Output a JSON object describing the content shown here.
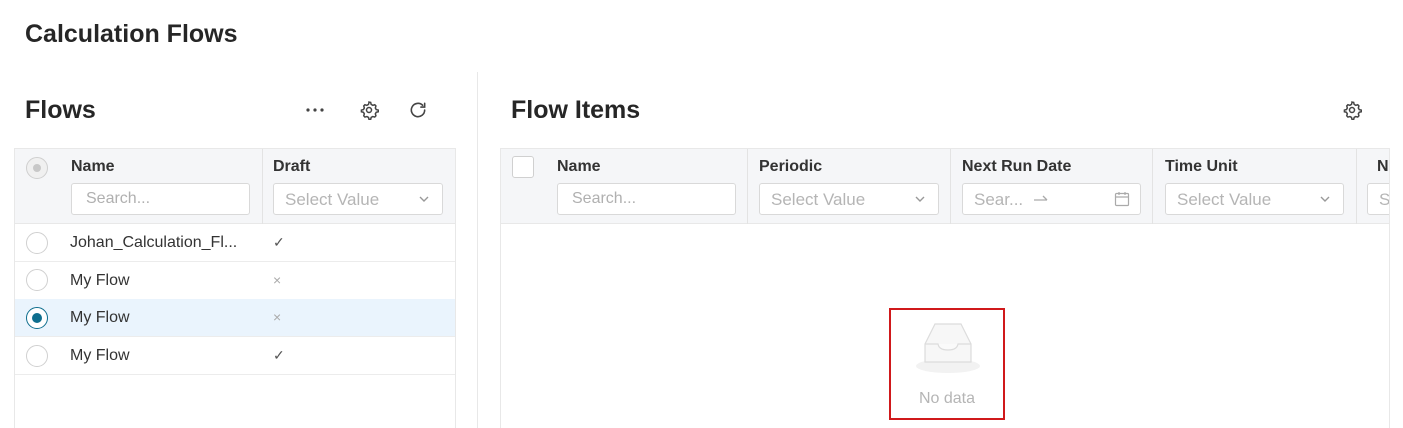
{
  "page": {
    "title": "Calculation Flows"
  },
  "flows": {
    "title": "Flows",
    "toolbar": {
      "more": "more-icon",
      "settings": "gear-icon",
      "refresh": "refresh-icon"
    },
    "columns": {
      "name": "Name",
      "draft": "Draft"
    },
    "filters": {
      "name_placeholder": "Search...",
      "draft_placeholder": "Select Value"
    },
    "rows": [
      {
        "name": "Johan_Calculation_Fl...",
        "draft": "✓",
        "selected": false
      },
      {
        "name": "My Flow",
        "draft": "×",
        "selected": false
      },
      {
        "name": "My Flow",
        "draft": "×",
        "selected": true
      },
      {
        "name": "My Flow",
        "draft": "✓",
        "selected": false
      }
    ]
  },
  "flow_items": {
    "title": "Flow Items",
    "toolbar": {
      "settings": "gear-icon"
    },
    "columns": {
      "name": "Name",
      "periodic": "Periodic",
      "next_run_date": "Next Run Date",
      "time_unit": "Time Unit",
      "next": "N"
    },
    "filters": {
      "name_placeholder": "Search...",
      "periodic_placeholder": "Select Value",
      "date_placeholder": "Sear...",
      "time_unit_placeholder": "Select Value",
      "next_placeholder": "S"
    },
    "empty": {
      "text": "No data",
      "icon": "inbox-empty-icon"
    }
  },
  "colors": {
    "accent": "#0e6e8e",
    "selected_row": "#eaf4fd",
    "highlight_border": "#d0191b"
  }
}
